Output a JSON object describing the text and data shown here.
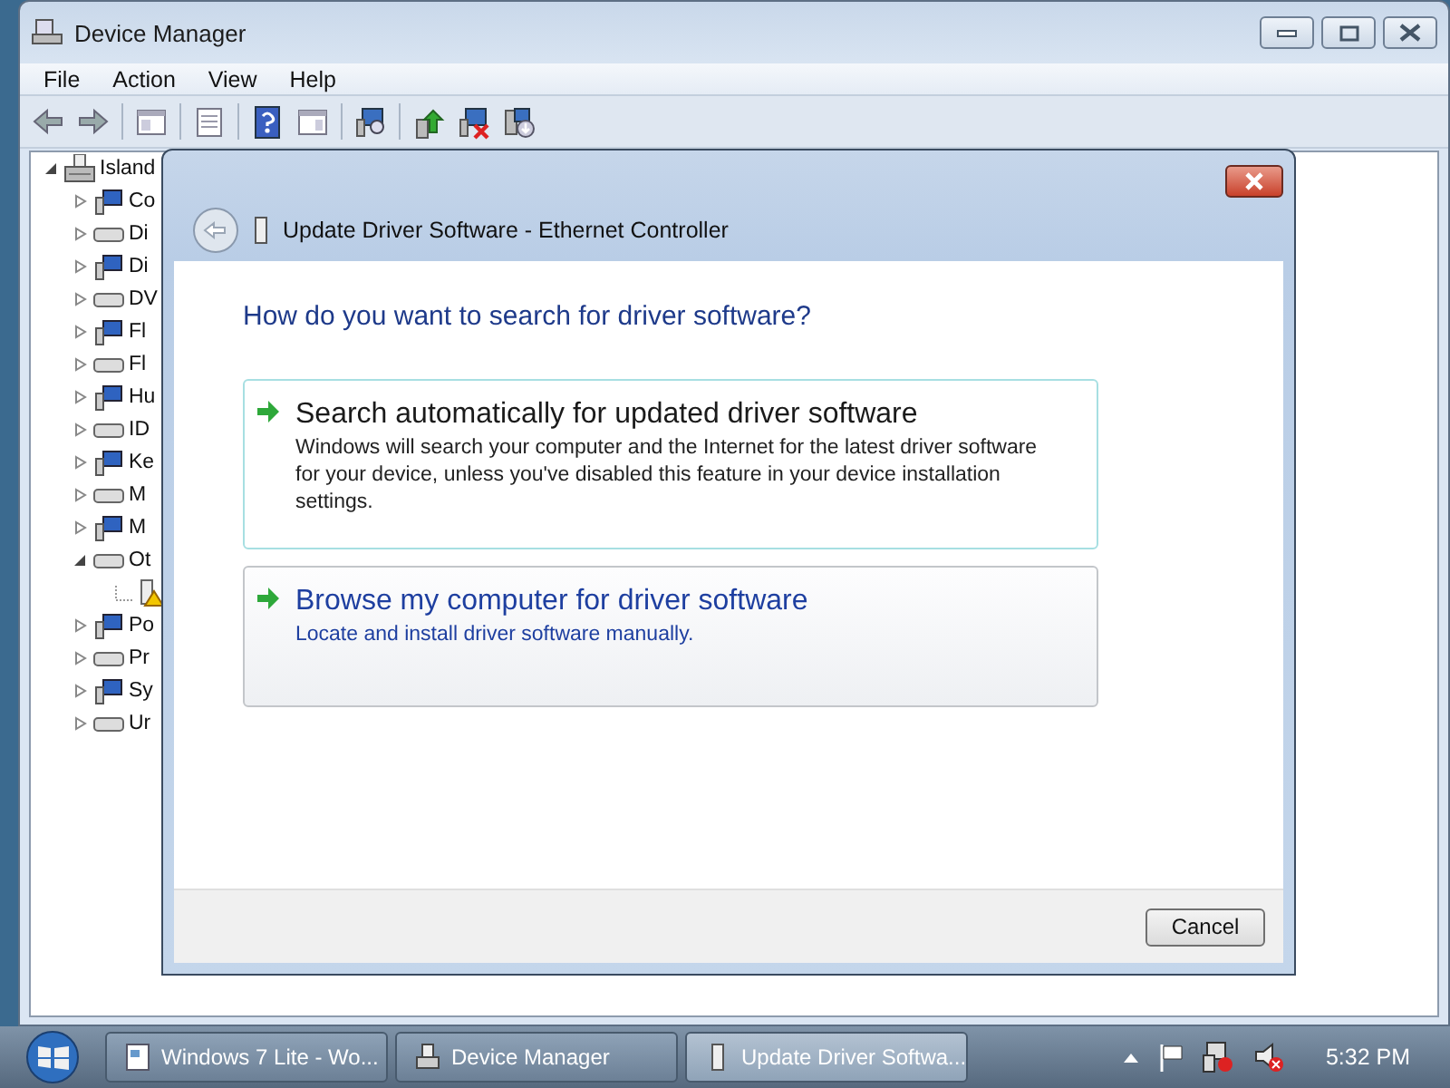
{
  "device_manager": {
    "title": "Device Manager",
    "menu": [
      "File",
      "Action",
      "View",
      "Help"
    ],
    "tree": {
      "label": "Island",
      "expanded": true,
      "children": [
        {
          "label": "Co",
          "expanded": false
        },
        {
          "label": "Di",
          "expanded": false
        },
        {
          "label": "Di",
          "expanded": false
        },
        {
          "label": "DV",
          "expanded": false
        },
        {
          "label": "Fl",
          "expanded": false
        },
        {
          "label": "Fl",
          "expanded": false
        },
        {
          "label": "Hu",
          "expanded": false
        },
        {
          "label": "ID",
          "expanded": false
        },
        {
          "label": "Ke",
          "expanded": false
        },
        {
          "label": "M",
          "expanded": false
        },
        {
          "label": "M",
          "expanded": false
        },
        {
          "label": "Ot",
          "expanded": true,
          "children": [
            {
              "warning": true
            }
          ]
        },
        {
          "label": "Po",
          "expanded": false
        },
        {
          "label": "Pr",
          "expanded": false
        },
        {
          "label": "Sy",
          "expanded": false
        },
        {
          "label": "Ur",
          "expanded": false
        }
      ]
    }
  },
  "dialog": {
    "title": "Update Driver Software - Ethernet Controller",
    "heading": "How do you want to search for driver software?",
    "options": [
      {
        "title": "Search automatically for updated driver software",
        "description": "Windows will search your computer and the Internet for the latest driver software for your device, unless you've disabled this feature in your device installation settings.",
        "hovered": false
      },
      {
        "title": "Browse my computer for driver software",
        "description": "Locate and install driver software manually.",
        "hovered": true
      }
    ],
    "cancel": "Cancel"
  },
  "taskbar": {
    "buttons": [
      {
        "label": "Windows 7 Lite - Wo...",
        "selected": false
      },
      {
        "label": "Device Manager",
        "selected": false
      },
      {
        "label": "Update Driver Softwa...",
        "selected": true
      }
    ],
    "clock": "5:32 PM"
  }
}
